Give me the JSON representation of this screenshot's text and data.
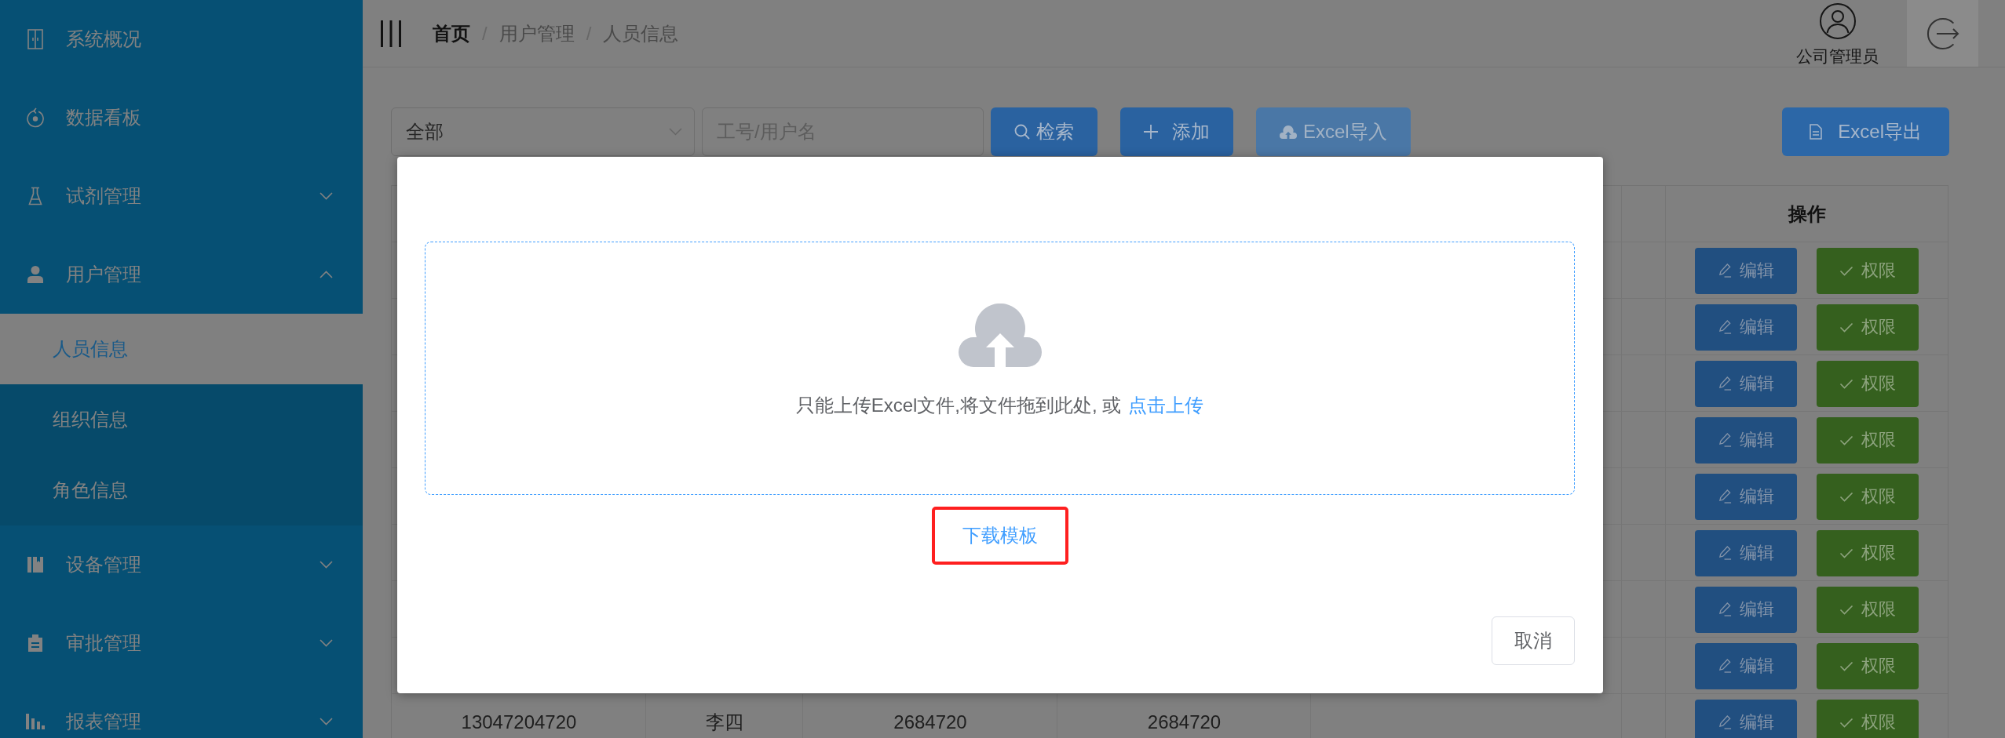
{
  "sidebar": {
    "items": [
      {
        "kind": "link",
        "label": "系统概况"
      },
      {
        "kind": "link",
        "label": "数据看板"
      },
      {
        "kind": "group",
        "label": "试剂管理",
        "expanded": false
      },
      {
        "kind": "group",
        "label": "用户管理",
        "expanded": true,
        "children": [
          {
            "label": "人员信息",
            "selected": true
          },
          {
            "label": "组织信息",
            "selected": false
          },
          {
            "label": "角色信息",
            "selected": false
          }
        ]
      },
      {
        "kind": "group",
        "label": "设备管理",
        "expanded": false
      },
      {
        "kind": "group",
        "label": "审批管理",
        "expanded": false
      },
      {
        "kind": "group",
        "label": "报表管理",
        "expanded": false
      }
    ]
  },
  "header": {
    "breadcrumb": [
      {
        "label": "首页",
        "link": true,
        "separator": "/"
      },
      {
        "label": "用户管理",
        "link": false,
        "separator": "/"
      },
      {
        "label": "人员信息",
        "link": false
      }
    ],
    "user": {
      "name": "公司管理员"
    }
  },
  "toolbar": {
    "select": {
      "value": "全部"
    },
    "search_field": {
      "placeholder": "工号/用户名"
    },
    "buttons": [
      {
        "kind": "search",
        "label": "检索",
        "disabled": false
      },
      {
        "kind": "add",
        "label": "添加",
        "disabled": false
      },
      {
        "kind": "import",
        "label": "Excel导入",
        "disabled": true
      }
    ],
    "export_button": {
      "kind": "export",
      "label": "Excel导出",
      "disabled": false
    }
  },
  "table": {
    "action_column": "操作",
    "rows": [
      {
        "actions": [
          {
            "kind": "edit",
            "label": "编辑"
          },
          {
            "kind": "permission",
            "label": "权限"
          }
        ]
      },
      {
        "actions": [
          {
            "kind": "edit",
            "label": "编辑"
          },
          {
            "kind": "permission",
            "label": "权限"
          }
        ]
      },
      {
        "actions": [
          {
            "kind": "edit",
            "label": "编辑"
          },
          {
            "kind": "permission",
            "label": "权限"
          }
        ]
      },
      {
        "actions": [
          {
            "kind": "edit",
            "label": "编辑"
          },
          {
            "kind": "permission",
            "label": "权限"
          }
        ]
      },
      {
        "actions": [
          {
            "kind": "edit",
            "label": "编辑"
          },
          {
            "kind": "permission",
            "label": "权限"
          }
        ]
      },
      {
        "actions": [
          {
            "kind": "edit",
            "label": "编辑"
          },
          {
            "kind": "permission",
            "label": "权限"
          }
        ]
      },
      {
        "actions": [
          {
            "kind": "edit",
            "label": "编辑"
          },
          {
            "kind": "permission",
            "label": "权限"
          }
        ]
      },
      {
        "actions": [
          {
            "kind": "edit",
            "label": "编辑"
          },
          {
            "kind": "permission",
            "label": "权限"
          }
        ]
      },
      {
        "cells": [
          "13047204720",
          "李四",
          "2684720",
          "2684720"
        ],
        "actions": [
          {
            "kind": "edit",
            "label": "编辑"
          },
          {
            "kind": "permission",
            "label": "权限"
          }
        ]
      }
    ]
  },
  "modal": {
    "upload": {
      "hint": "只能上传Excel文件,将文件拖到此处, 或",
      "link": "点击上传"
    },
    "template_link": {
      "label": "下载模板",
      "highlighted": true
    },
    "cancel_button": "取消"
  }
}
